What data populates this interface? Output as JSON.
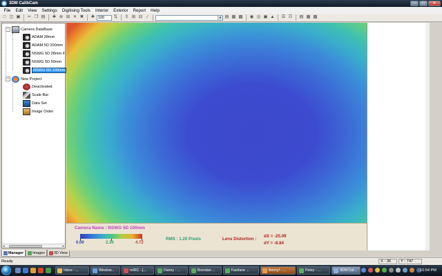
{
  "window": {
    "title": "3DM CalibCam",
    "buttons": {
      "minimize": "–",
      "maximize": "□",
      "close": "✕"
    }
  },
  "menu": [
    "File",
    "Edit",
    "View",
    "Settings",
    "Digitising Tools",
    "Interior",
    "Exterior",
    "Report",
    "Help"
  ],
  "toolbar": {
    "zoom_value": "100",
    "combo_value": "",
    "icons": [
      "new-icon",
      "open-icon",
      "save-icon",
      "cut-icon",
      "copy-icon",
      "paste-icon",
      "zoom-in-icon",
      "zoom-out-icon",
      "pan-icon",
      "point-icon",
      "camera-icon",
      "grid-icon"
    ]
  },
  "tree": {
    "camera_db": {
      "label": "Camera DataBase",
      "toggle": "–",
      "cameras": [
        {
          "label": "ADAM 28mm"
        },
        {
          "label": "ADAM 5D 200mm"
        },
        {
          "label": "NSWG 5D 28mm F"
        },
        {
          "label": "NSWG 5D 50mm"
        },
        {
          "label": "NSWG 5D 100mm",
          "selected": true
        }
      ]
    },
    "project": {
      "label": "New Project",
      "toggle": "–",
      "items": [
        {
          "label": "Deactivated",
          "icon": "deactivated-icon"
        },
        {
          "label": "Scale Bar",
          "icon": "scale-bar-icon"
        },
        {
          "label": "Data Set",
          "icon": "data-set-icon"
        },
        {
          "label": "Image Order",
          "icon": "image-order-icon"
        }
      ]
    },
    "scroll": {
      "left": "◂",
      "right": "▸"
    }
  },
  "tabs": [
    {
      "label": "Manager",
      "active": true
    },
    {
      "label": "Images",
      "active": false
    },
    {
      "label": "3D View",
      "active": false
    }
  ],
  "info": {
    "camera_name": "Camera Name : NSWG 5D 100mm",
    "colorbar_min": "0.00",
    "colorbar_mid": "2.36",
    "colorbar_max": "4.72",
    "rms": "RMS : 1.20 Pixels",
    "lens_distortion": "Lens Distortion :",
    "dx": "dX = -25.09",
    "dy": "dY = -8.84",
    "colors": {
      "min": "#3040c0",
      "mid": "#3aa060",
      "max": "#c04040"
    }
  },
  "status": {
    "ready": "Ready",
    "x": "X : 36",
    "y": "Y : 747"
  },
  "taskbar": {
    "tasks": [
      {
        "label": "Inbox - ..."
      },
      {
        "label": "Window..."
      },
      {
        "label": "mIRC - [..."
      },
      {
        "label": "Danny - ..."
      },
      {
        "label": "Brendan ..."
      },
      {
        "label": "Fastlane ..."
      },
      {
        "label": "Benny! - ..."
      },
      {
        "label": "Petey - ..."
      },
      {
        "label": "3DM Cal...",
        "active": true
      }
    ],
    "clock": "10:54 PM"
  }
}
